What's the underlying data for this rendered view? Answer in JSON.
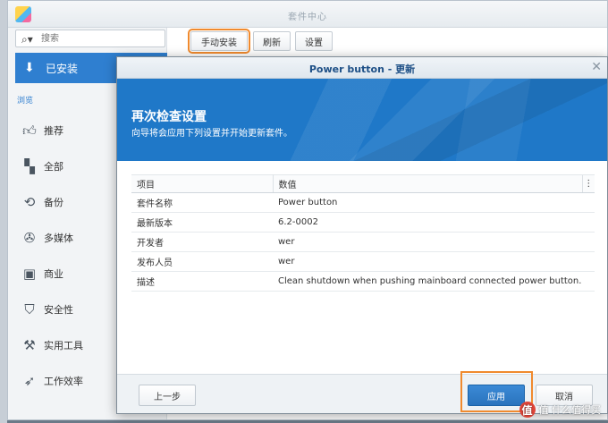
{
  "window": {
    "title": "套件中心"
  },
  "search": {
    "placeholder": "搜索"
  },
  "sidebar": {
    "installed_label": "已安装",
    "browse_label": "浏览",
    "items": [
      {
        "label": "推荐",
        "icon": "thumbs-up-icon"
      },
      {
        "label": "全部",
        "icon": "grid-icon"
      },
      {
        "label": "备份",
        "icon": "backup-icon"
      },
      {
        "label": "多媒体",
        "icon": "film-reel-icon"
      },
      {
        "label": "商业",
        "icon": "shop-icon"
      },
      {
        "label": "安全性",
        "icon": "shield-icon"
      },
      {
        "label": "实用工具",
        "icon": "wrench-icon"
      },
      {
        "label": "工作效率",
        "icon": "rocket-icon"
      }
    ]
  },
  "toolbar": {
    "manual_install": "手动安装",
    "refresh": "刷新",
    "settings": "设置"
  },
  "dialog": {
    "title": "Power button - 更新",
    "banner_title": "再次检查设置",
    "banner_subtitle": "向导将会应用下列设置并开始更新套件。",
    "columns": [
      "项目",
      "数值"
    ],
    "rows": [
      {
        "key": "套件名称",
        "value": "Power button"
      },
      {
        "key": "最新版本",
        "value": "6.2-0002"
      },
      {
        "key": "开发者",
        "value": "wer"
      },
      {
        "key": "发布人员",
        "value": "wer"
      },
      {
        "key": "描述",
        "value": "Clean shutdown when pushing mainboard connected power button."
      }
    ],
    "back_label": "上一步",
    "apply_label": "应用",
    "cancel_label": "取消"
  },
  "watermark": {
    "text": "值 什么值得买",
    "badge": "值"
  },
  "colors": {
    "accent": "#2f7fd0",
    "highlight": "#f08a2e",
    "banner": "#1f78c8"
  }
}
